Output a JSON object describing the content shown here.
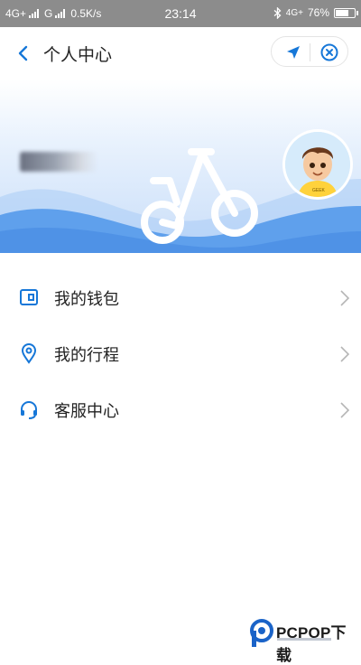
{
  "status_bar": {
    "network1": "4G+",
    "network2": "G",
    "speed": "0.5K/s",
    "time": "23:14",
    "right_network": "4G+",
    "battery_text": "76%",
    "battery_level": 0.76
  },
  "header": {
    "title": "个人中心"
  },
  "menu": {
    "items": [
      {
        "label": "我的钱包",
        "icon": "wallet-icon"
      },
      {
        "label": "我的行程",
        "icon": "location-pin-icon"
      },
      {
        "label": "客服中心",
        "icon": "headset-icon"
      }
    ]
  },
  "colors": {
    "accent": "#1677d8",
    "status_bar": "#8c8c8c",
    "banner_light": "#e9f2fd",
    "banner_blue": "#5fa0ec"
  },
  "avatar": {
    "badge": "GEEK"
  },
  "watermark": {
    "text": "PCPOP下载"
  }
}
